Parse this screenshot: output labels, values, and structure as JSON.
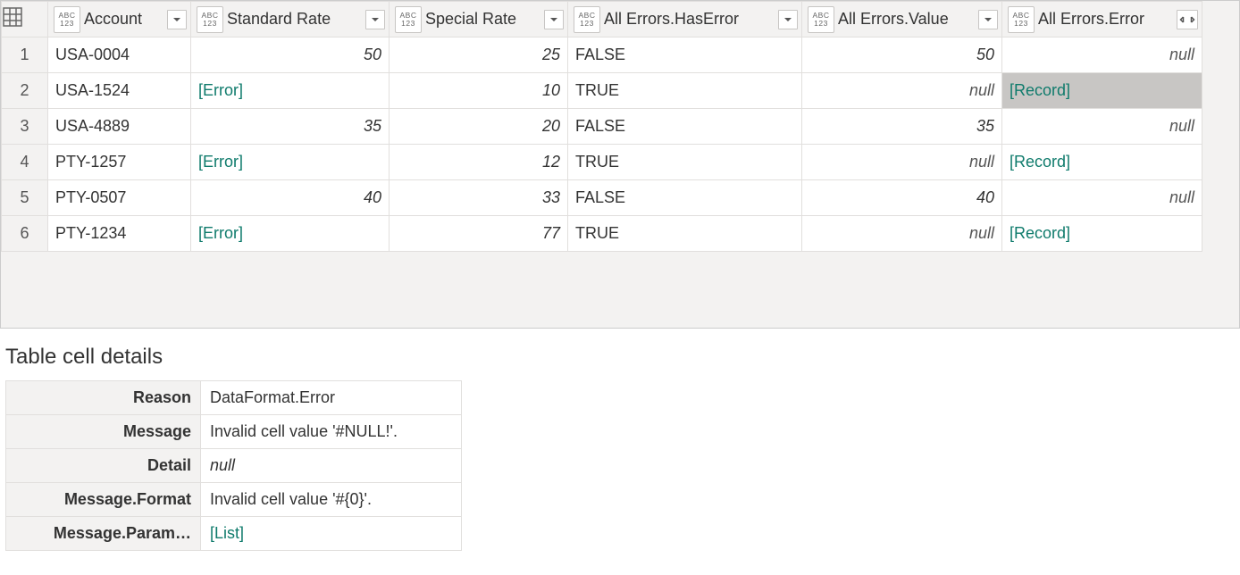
{
  "columns": [
    {
      "name": "Account",
      "type": "any",
      "filter": true
    },
    {
      "name": "Standard Rate",
      "type": "any",
      "filter": true
    },
    {
      "name": "Special Rate",
      "type": "any",
      "filter": true
    },
    {
      "name": "All Errors.HasError",
      "type": "any",
      "filter": true
    },
    {
      "name": "All Errors.Value",
      "type": "any",
      "filter": true
    },
    {
      "name": "All Errors.Error",
      "type": "any",
      "expand": true
    }
  ],
  "rows": [
    {
      "n": "1",
      "cells": [
        {
          "v": "USA-0004",
          "cls": "txt"
        },
        {
          "v": "50",
          "cls": "num"
        },
        {
          "v": "25",
          "cls": "num"
        },
        {
          "v": "FALSE",
          "cls": "txt"
        },
        {
          "v": "50",
          "cls": "num"
        },
        {
          "v": "null",
          "cls": "nullval"
        }
      ]
    },
    {
      "n": "2",
      "cells": [
        {
          "v": "USA-1524",
          "cls": "txt"
        },
        {
          "v": "[Error]",
          "cls": "link"
        },
        {
          "v": "10",
          "cls": "num"
        },
        {
          "v": "TRUE",
          "cls": "txt"
        },
        {
          "v": "null",
          "cls": "nullval"
        },
        {
          "v": "[Record]",
          "cls": "link selected"
        }
      ]
    },
    {
      "n": "3",
      "cells": [
        {
          "v": "USA-4889",
          "cls": "txt"
        },
        {
          "v": "35",
          "cls": "num"
        },
        {
          "v": "20",
          "cls": "num"
        },
        {
          "v": "FALSE",
          "cls": "txt"
        },
        {
          "v": "35",
          "cls": "num"
        },
        {
          "v": "null",
          "cls": "nullval"
        }
      ]
    },
    {
      "n": "4",
      "cells": [
        {
          "v": "PTY-1257",
          "cls": "txt"
        },
        {
          "v": "[Error]",
          "cls": "link"
        },
        {
          "v": "12",
          "cls": "num"
        },
        {
          "v": "TRUE",
          "cls": "txt"
        },
        {
          "v": "null",
          "cls": "nullval"
        },
        {
          "v": "[Record]",
          "cls": "link"
        }
      ]
    },
    {
      "n": "5",
      "cells": [
        {
          "v": "PTY-0507",
          "cls": "txt"
        },
        {
          "v": "40",
          "cls": "num"
        },
        {
          "v": "33",
          "cls": "num"
        },
        {
          "v": "FALSE",
          "cls": "txt"
        },
        {
          "v": "40",
          "cls": "num"
        },
        {
          "v": "null",
          "cls": "nullval"
        }
      ]
    },
    {
      "n": "6",
      "cells": [
        {
          "v": "PTY-1234",
          "cls": "txt"
        },
        {
          "v": "[Error]",
          "cls": "link"
        },
        {
          "v": "77",
          "cls": "num"
        },
        {
          "v": "TRUE",
          "cls": "txt"
        },
        {
          "v": "null",
          "cls": "nullval"
        },
        {
          "v": "[Record]",
          "cls": "link"
        }
      ]
    }
  ],
  "details": {
    "title": "Table cell details",
    "rows": [
      {
        "label": "Reason",
        "value": "DataFormat.Error",
        "cls": ""
      },
      {
        "label": "Message",
        "value": "Invalid cell value '#NULL!'.",
        "cls": ""
      },
      {
        "label": "Detail",
        "value": "null",
        "cls": "italic"
      },
      {
        "label": "Message.Format",
        "value": "Invalid cell value '#{0}'.",
        "cls": ""
      },
      {
        "label": "Message.Param…",
        "value": "[List]",
        "cls": "link-txt"
      }
    ]
  }
}
